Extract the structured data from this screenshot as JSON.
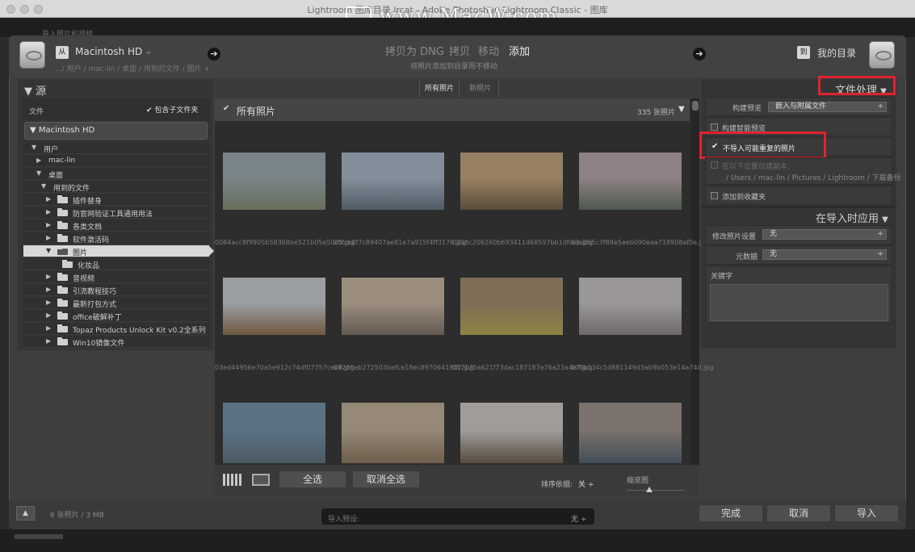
{
  "window": {
    "title": "Lightroom 图库目录.lrcat - Adobe Photoshop Lightroom Classic - 图库",
    "watermark": "www.MacW.com",
    "back_label": "导入照片和视频"
  },
  "header": {
    "from_badge": "从",
    "source_name": "Macintosh HD",
    "source_path": ".../ 用户 / mac-lin / 桌面 / 用到的文件 / 图片 +",
    "modes": [
      "拷贝为 DNG",
      "拷贝",
      "移动",
      "添加"
    ],
    "active_mode": "添加",
    "mode_subtitle": "将照片添加到目录而不移动",
    "to_badge": "到",
    "destination": "我的目录"
  },
  "source_panel": {
    "title": "源",
    "files_label": "文件",
    "include_subfolders": "包含子文件夹",
    "volume": "Macintosh HD",
    "tree": [
      {
        "label": "用户",
        "indent": 0,
        "expanded": true,
        "folder": false
      },
      {
        "label": "mac-lin",
        "indent": 1,
        "expanded": false,
        "folder": false
      },
      {
        "label": "桌面",
        "indent": 1,
        "expanded": true,
        "folder": false
      },
      {
        "label": "用到的文件",
        "indent": 2,
        "expanded": true,
        "folder": false
      },
      {
        "label": "插件替身",
        "indent": 3,
        "expanded": false,
        "folder": true
      },
      {
        "label": "防官网验证工具通用用法",
        "indent": 3,
        "expanded": false,
        "folder": true
      },
      {
        "label": "各类文档",
        "indent": 3,
        "expanded": false,
        "folder": true
      },
      {
        "label": "软件激活码",
        "indent": 3,
        "expanded": false,
        "folder": true
      },
      {
        "label": "图片",
        "indent": 3,
        "expanded": true,
        "folder": true,
        "selected": true
      },
      {
        "label": "化妆品",
        "indent": 4,
        "expanded": false,
        "folder": true,
        "leaf": true
      },
      {
        "label": "音视频",
        "indent": 3,
        "expanded": false,
        "folder": true
      },
      {
        "label": "引流教程技巧",
        "indent": 3,
        "expanded": false,
        "folder": true
      },
      {
        "label": "最新打包方式",
        "indent": 3,
        "expanded": false,
        "folder": true
      },
      {
        "label": "office破解补丁",
        "indent": 3,
        "expanded": false,
        "folder": true
      },
      {
        "label": "Topaz Products Unlock Kit v0.2全系列",
        "indent": 3,
        "expanded": false,
        "folder": true
      },
      {
        "label": "Win10镜像文件",
        "indent": 3,
        "expanded": false,
        "folder": true
      }
    ]
  },
  "grid": {
    "tabs": [
      "所有照片",
      "新照片"
    ],
    "header_label": "所有照片",
    "count": "335 张照片",
    "photos": [
      {
        "file": "0084acc8f9905b58368be521b05e50c5.jpg",
        "colors": [
          "#9aa9b0",
          "#7f8b6c"
        ]
      },
      {
        "file": "00fcb0f7c89407ae81e7a915f4ff3176.jpg",
        "colors": [
          "#a8b8c8",
          "#5d6f7c"
        ]
      },
      {
        "file": "0208c206260b693411d68597bb1dfdec.jpg",
        "colors": [
          "#c6a47a",
          "#6c5a3e"
        ]
      },
      {
        "file": "03e055c3f88e5eeb090eaa718908af0e.jpg",
        "colors": [
          "#b8a5a8",
          "#5d6b5f"
        ]
      },
      {
        "file": "03ed44956e70a5e912c74df07757cec9.jpg",
        "colors": [
          "#c9cfd4",
          "#8a6a48"
        ]
      },
      {
        "file": "04266eb272503befce18ec8970641832.jpg",
        "colors": [
          "#cbb7a2",
          "#7a6c60"
        ]
      },
      {
        "file": "057125a621f73dac187187e76a23a4e7.jpg",
        "colors": [
          "#a08a66",
          "#b8a850"
        ]
      },
      {
        "file": "078b134c5d881149d3ab9b053e14a74d.jpg",
        "colors": [
          "#c8c4c6",
          "#8a8380"
        ]
      },
      {
        "file": "",
        "colors": [
          "#6f8fa8",
          "#5a6d7a"
        ]
      },
      {
        "file": "",
        "colors": [
          "#c2b098",
          "#8a7258"
        ]
      },
      {
        "file": "",
        "colors": [
          "#d0ccc8",
          "#6a5a48"
        ]
      },
      {
        "file": "",
        "colors": [
          "#9c9088",
          "#4d5c6a"
        ]
      }
    ],
    "select_all": "全选",
    "deselect_all": "取消全选",
    "sort_label": "排序依据:",
    "sort_value": "关",
    "thumb_label": "缩览图"
  },
  "file_handling": {
    "title": "文件处理",
    "build_previews_label": "构建预览",
    "build_previews_value": "嵌入与附属文件",
    "smart_previews": "构建智能预览",
    "dont_import_duplicates": "不导入可能重复的照片",
    "second_copy_label": "在以下位置创建副本:",
    "second_copy_path": "/ Users / mac-lin / Pictures / Lightroom / 下载备份",
    "add_to_collection": "添加到收藏夹"
  },
  "apply_during_import": {
    "title": "在导入时应用",
    "develop_label": "修改照片设置",
    "develop_value": "无",
    "metadata_label": "元数据",
    "metadata_value": "无",
    "keywords_label": "关键字"
  },
  "footer": {
    "info": "6 张照片 / 3 MB",
    "preset_label": "导入预设:",
    "preset_value": "无 ÷",
    "done": "完成",
    "cancel": "取消",
    "import": "导入"
  },
  "colors": {
    "highlight_red": "#e0232f",
    "panel_bg": "#353535"
  }
}
